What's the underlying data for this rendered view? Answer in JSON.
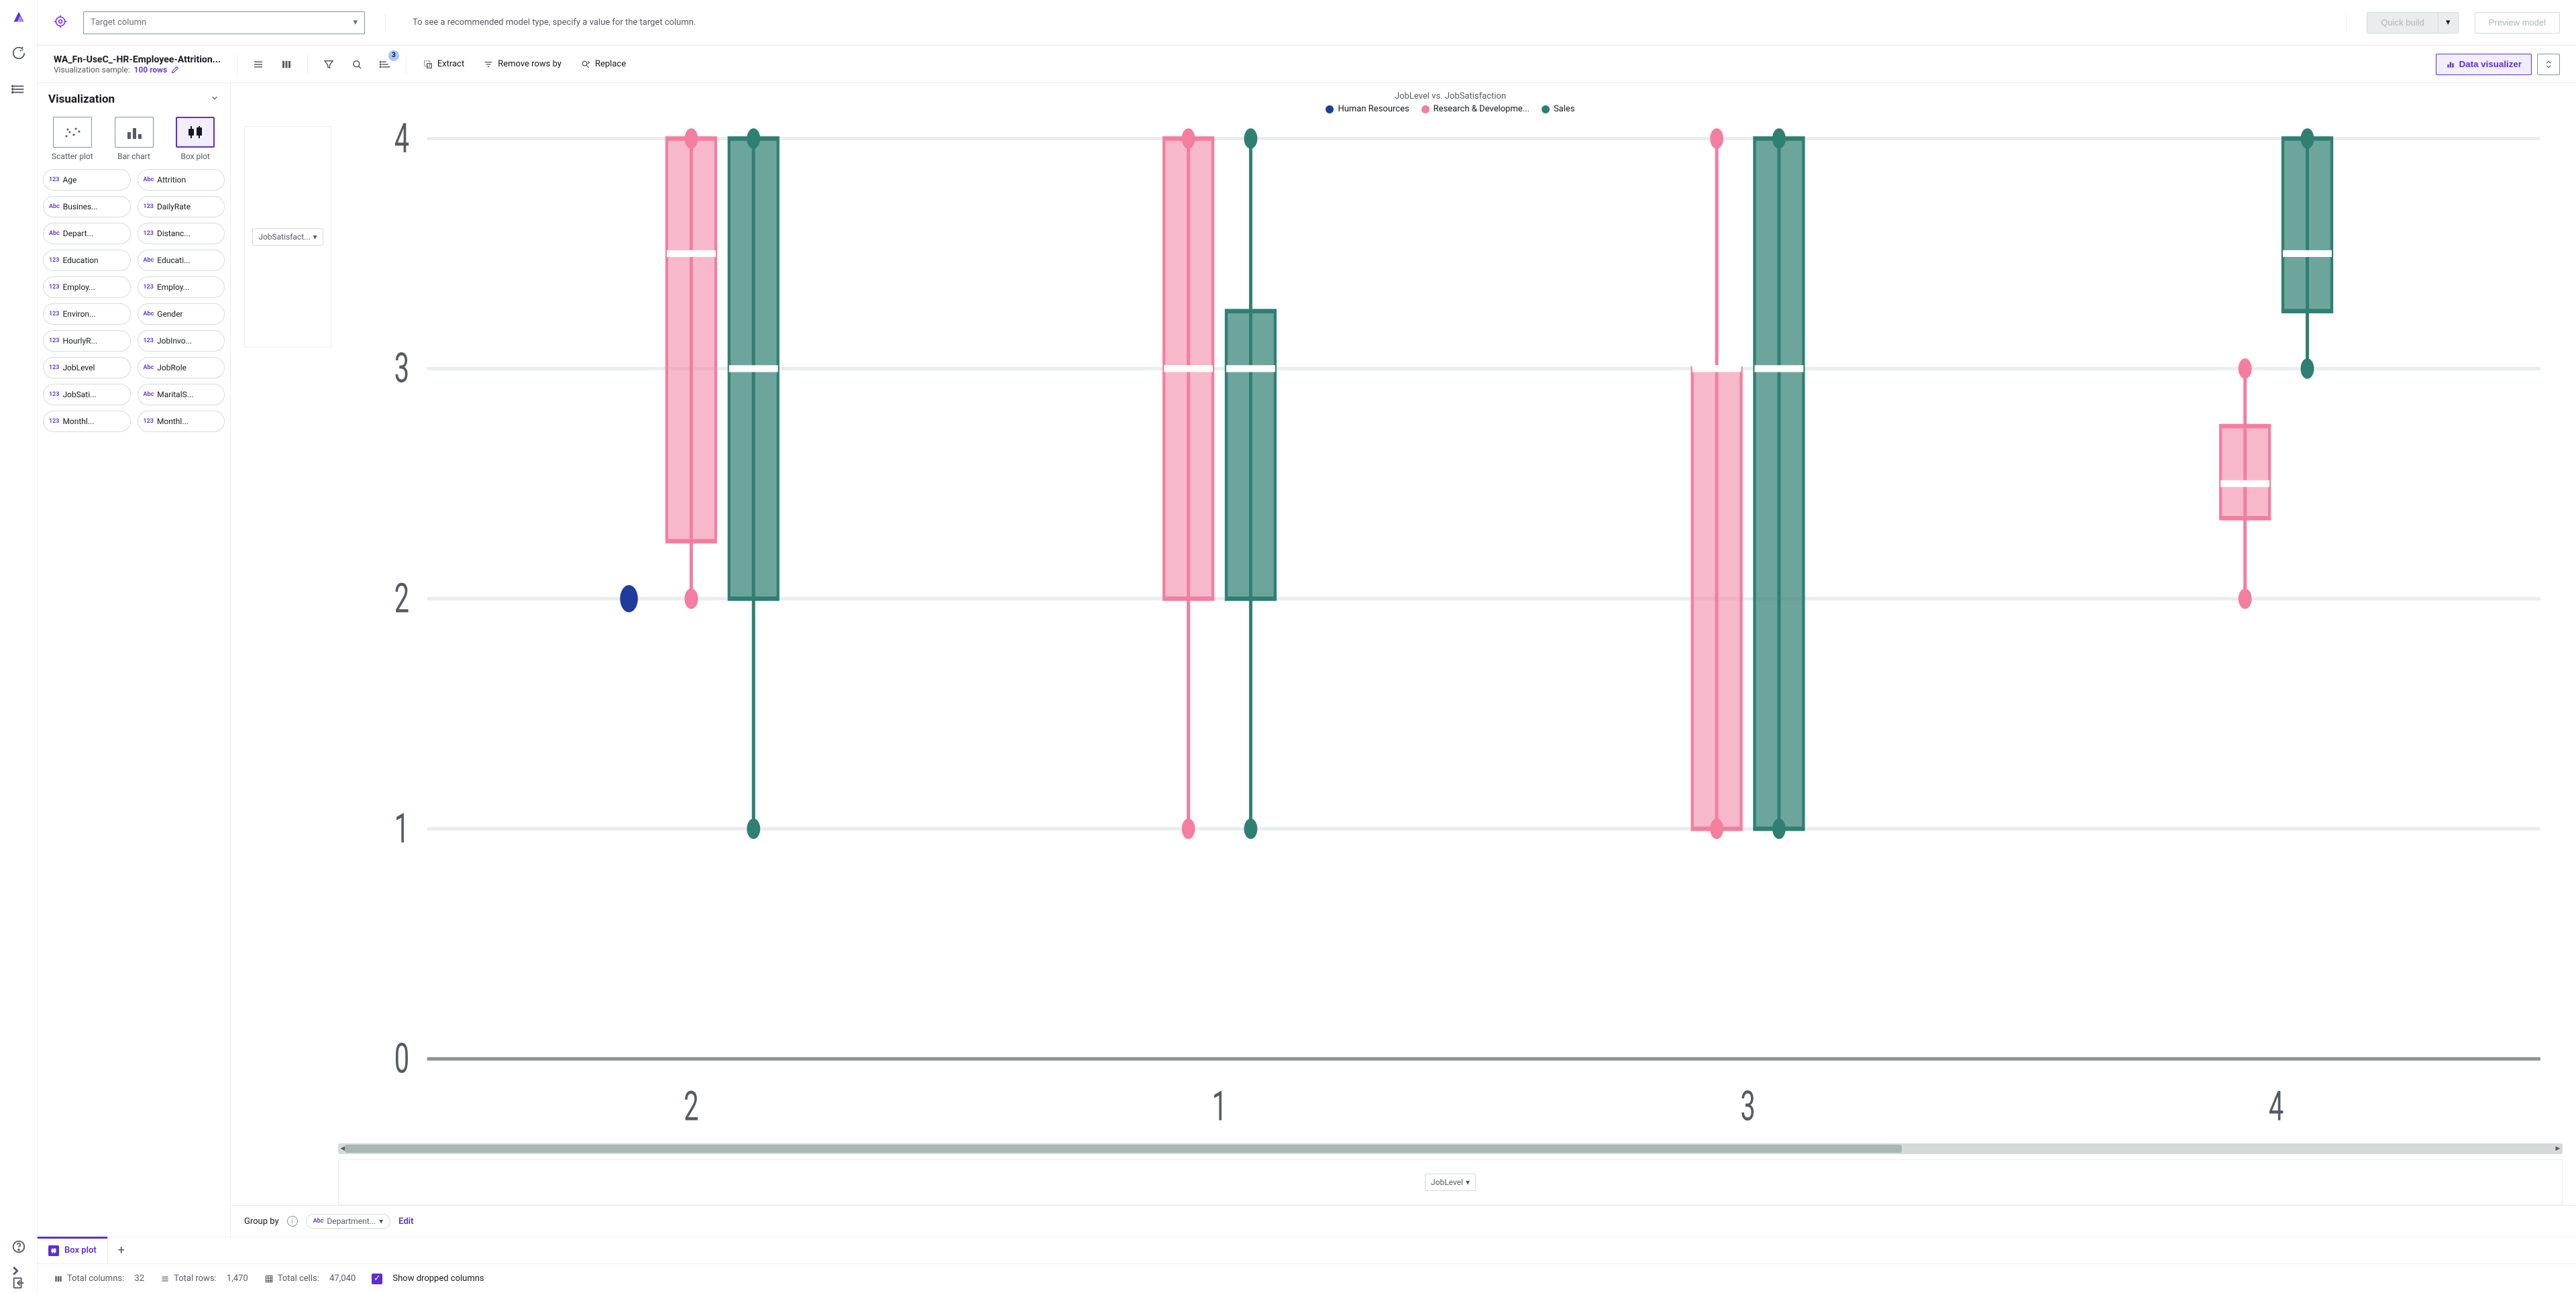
{
  "topbar": {
    "target_placeholder": "Target column",
    "hint": "To see a recommended model type, specify a value for the target column.",
    "quick_build": "Quick build",
    "preview_model": "Preview model"
  },
  "secondbar": {
    "dataset": "WA_Fn-UseC_-HR-Employee-Attrition...",
    "sample_label": "Visualization sample:",
    "sample_value": "100 rows",
    "sort_badge": "3",
    "extract": "Extract",
    "remove_rows": "Remove rows by",
    "replace": "Replace",
    "data_visualizer": "Data visualizer"
  },
  "viz": {
    "header": "Visualization",
    "types": {
      "scatter": "Scatter plot",
      "bar": "Bar chart",
      "box": "Box plot"
    },
    "columns": [
      [
        "123",
        "Age",
        "Abc",
        "Attrition"
      ],
      [
        "Abc",
        "Busines...",
        "123",
        "DailyRate"
      ],
      [
        "Abc",
        "Depart...",
        "123",
        "Distanc..."
      ],
      [
        "123",
        "Education",
        "Abc",
        "Educati..."
      ],
      [
        "123",
        "Employ...",
        "123",
        "Employ..."
      ],
      [
        "123",
        "Environ...",
        "Abc",
        "Gender"
      ],
      [
        "123",
        "HourlyR...",
        "123",
        "JobInvo..."
      ],
      [
        "123",
        "JobLevel",
        "Abc",
        "JobRole"
      ],
      [
        "123",
        "JobSati...",
        "Abc",
        "MaritalS..."
      ],
      [
        "123",
        "Monthl...",
        "123",
        "Monthl..."
      ]
    ]
  },
  "chart_data": {
    "type": "boxplot",
    "title": "JobLevel vs. JobSatisfaction",
    "xlabel": "JobLevel",
    "ylabel": "JobSatisfaction",
    "ylim": [
      0,
      4
    ],
    "yticks": [
      0,
      1,
      2,
      3,
      4
    ],
    "categories": [
      "2",
      "1",
      "3",
      "4"
    ],
    "series_colors": {
      "Human Resources": "#1f3b9b",
      "Research & Development": "#f37ea0",
      "Sales": "#2f7f73"
    },
    "legend": [
      "Human Resources",
      "Research & Developme...",
      "Sales"
    ],
    "groups": [
      {
        "x": "2",
        "boxes": [
          {
            "series": "Human Resources",
            "render": "point",
            "value": 2
          },
          {
            "series": "Research & Development",
            "min": 2,
            "q1": 2.25,
            "median": 3.5,
            "q3": 4,
            "max": 4,
            "outliers": [
              2
            ]
          },
          {
            "series": "Sales",
            "min": 1,
            "q1": 2,
            "median": 3,
            "q3": 4,
            "max": 4
          }
        ]
      },
      {
        "x": "1",
        "boxes": [
          {
            "series": "Research & Development",
            "min": 1,
            "q1": 2,
            "median": 3,
            "q3": 4,
            "max": 4
          },
          {
            "series": "Sales",
            "min": 1,
            "q1": 2,
            "median": 3,
            "q3": 3.25,
            "max": 4
          }
        ]
      },
      {
        "x": "3",
        "boxes": [
          {
            "series": "Research & Development",
            "min": 1,
            "q1": 1,
            "median": 3,
            "q3": 3,
            "max": 4
          },
          {
            "series": "Sales",
            "min": 1,
            "q1": 1,
            "median": 3,
            "q3": 4,
            "max": 4
          }
        ]
      },
      {
        "x": "4",
        "boxes": [
          {
            "series": "Research & Development",
            "min": 2,
            "q1": 2.35,
            "median": 2.5,
            "q3": 2.75,
            "max": 3
          },
          {
            "series": "Sales",
            "min": 3,
            "q1": 3.25,
            "median": 3.5,
            "q3": 4,
            "max": 4
          }
        ]
      }
    ]
  },
  "ydrop": "JobSatisfact...",
  "xdrop": "JobLevel",
  "groupby": {
    "label": "Group by",
    "chip_type": "Abc",
    "chip_value": "Department...",
    "edit": "Edit"
  },
  "tab": {
    "label": "Box plot"
  },
  "status": {
    "cols_label": "Total columns:",
    "cols_value": "32",
    "rows_label": "Total rows:",
    "rows_value": "1,470",
    "cells_label": "Total cells:",
    "cells_value": "47,040",
    "show_dropped": "Show dropped columns"
  }
}
